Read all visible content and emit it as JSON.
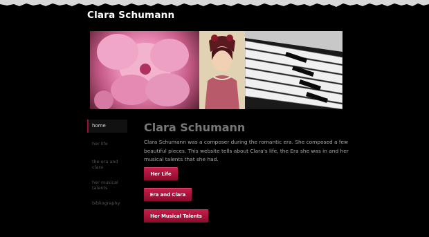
{
  "site": {
    "title": "Clara Schumann"
  },
  "banner": {
    "alt_flower": "",
    "alt_portrait": "",
    "alt_piano": ""
  },
  "nav": {
    "items": [
      {
        "label": "home"
      },
      {
        "label": "her life"
      },
      {
        "label": "the era and clara"
      },
      {
        "label": "her musical talents"
      },
      {
        "label": "bibliography"
      }
    ]
  },
  "main": {
    "heading": "Clara Schumann",
    "intro": "Clara Schumann was a composer during the romantic era. She composed a few beautiful pieces. This website tells about Clara's life, the Era she was in and her musical talents that she had.",
    "buttons": [
      {
        "label": "Her Life"
      },
      {
        "label": "Era and Clara"
      },
      {
        "label": "Her Musical Talents"
      }
    ]
  },
  "colors": {
    "accent": "#a00f2e",
    "button": "#b0163e",
    "background": "#000000"
  }
}
